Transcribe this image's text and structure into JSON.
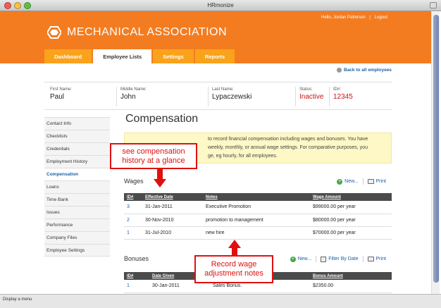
{
  "window": {
    "title": "HRmonize"
  },
  "header": {
    "greeting": "Hello, Jordan Patterson",
    "separator": "|",
    "logout": "Logout",
    "logo_text": "MECHANICAL ASSOCIATION",
    "tabs": [
      {
        "label": "Dashboard",
        "active": false
      },
      {
        "label": "Employee Lists",
        "active": true
      },
      {
        "label": "Settings",
        "active": false
      },
      {
        "label": "Reports",
        "active": false
      }
    ]
  },
  "back_link": "Back to all employees",
  "employee": {
    "first_name_label": "First Name:",
    "first_name": "Paul",
    "middle_name_label": "Middle Name:",
    "middle_name": "John",
    "last_name_label": "Last Name:",
    "last_name": "Lypaczewski",
    "status_label": "Status:",
    "status": "Inactive",
    "id_label": "ID#:",
    "id": "12345"
  },
  "sidebar": {
    "items": [
      {
        "label": "Contact Info"
      },
      {
        "label": "Checklists"
      },
      {
        "label": "Credentials"
      },
      {
        "label": "Employment History"
      },
      {
        "label": "Compensation"
      },
      {
        "label": "Loans"
      },
      {
        "label": "Time Bank"
      },
      {
        "label": "Issues"
      },
      {
        "label": "Performance"
      },
      {
        "label": "Company Files"
      },
      {
        "label": "Employee Settings"
      }
    ],
    "active_index": 4
  },
  "page": {
    "title": "Compensation",
    "note_lines": [
      "to record financial compensation including wages and bonuses. You have",
      "weekly, monthly, or annual wage settings. For comparative purposes, you",
      "ge, eg hourly, for all employees."
    ]
  },
  "wages": {
    "title": "Wages",
    "new_label": "New...",
    "print_label": "Print",
    "columns": [
      "ID#",
      "Effective Date",
      "Notes",
      "Wage Amount"
    ],
    "rows": [
      [
        "3",
        "31-Jan-2011",
        "Executive Promotion",
        "$99000.00 per year"
      ],
      [
        "2",
        "30-Nov-2010",
        "promotion to management",
        "$80000.00 per year"
      ],
      [
        "1",
        "31-Jul-2010",
        "new hire",
        "$70000.00 per year"
      ]
    ]
  },
  "bonuses": {
    "title": "Bonuses",
    "new_label": "New...",
    "filter_label": "Filter By Date",
    "print_label": "Print",
    "columns": [
      "ID#",
      "Date Given",
      "",
      "Bonus Amount"
    ],
    "rows": [
      [
        "1",
        "30-Jan-2011",
        "Sales Bonus.",
        "$2350.00"
      ]
    ]
  },
  "callouts": {
    "history": "see compensation history at a glance",
    "notes": "Record wage adjustment notes"
  },
  "statusbar": "Display a menu",
  "colors": {
    "brand_orange": "#f47c20",
    "tab_orange": "#f9a21b",
    "callout_red": "#e01010",
    "link_blue": "#1e5ea8"
  }
}
